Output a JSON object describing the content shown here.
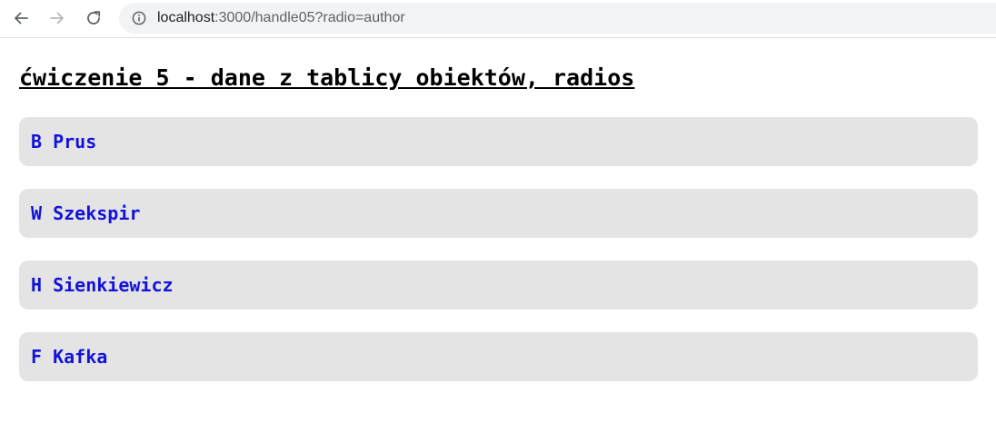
{
  "browser": {
    "url_host": "localhost",
    "url_rest": ":3000/handle05?radio=author"
  },
  "page": {
    "title": "ćwiczenie 5 - dane z tablicy obiektów, radios"
  },
  "authors": [
    {
      "label": "B Prus"
    },
    {
      "label": "W Szekspir"
    },
    {
      "label": "H Sienkiewicz"
    },
    {
      "label": "F Kafka"
    }
  ],
  "colors": {
    "item_background": "#e4e4e4",
    "item_text": "#1212d9",
    "title_text": "#000000"
  }
}
